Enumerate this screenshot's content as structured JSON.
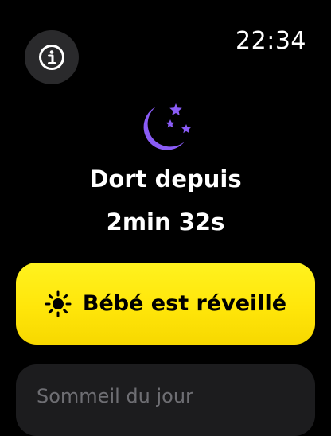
{
  "status_bar": {
    "time": "22:34"
  },
  "info_button": {
    "icon": "info-icon"
  },
  "sleep": {
    "icon": "moon-stars-icon",
    "accent_color": "#8a5cf6",
    "status_label": "Dort depuis",
    "duration": "2min 32s"
  },
  "wake_button": {
    "icon": "sun-icon",
    "label": "Bébé est réveillé",
    "color": "#ffe60a"
  },
  "card": {
    "title": "Sommeil du jour"
  }
}
